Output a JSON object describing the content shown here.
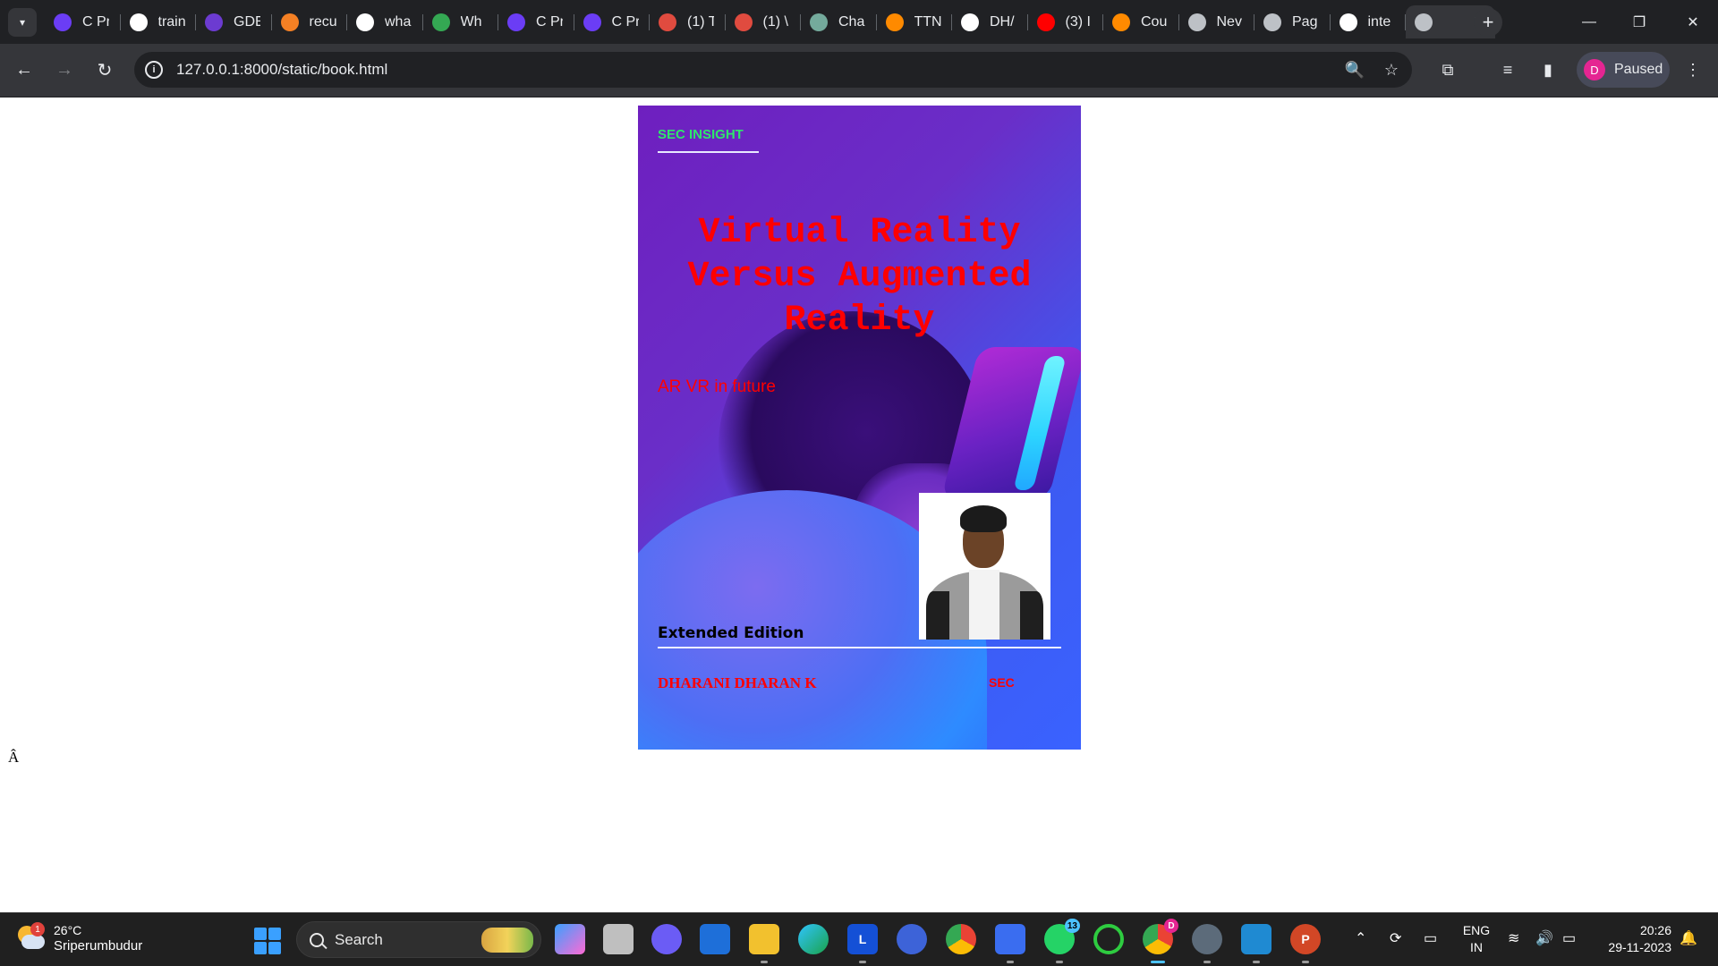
{
  "browser": {
    "tabs": [
      {
        "title": "C Pr",
        "icon": "pw-skills-icon",
        "color": "#6b3df5"
      },
      {
        "title": "train",
        "icon": "google-icon",
        "color": "#ffffff"
      },
      {
        "title": "GDE",
        "icon": "gdevelop-icon",
        "color": "#6c3bd1"
      },
      {
        "title": "recu",
        "icon": "stackoverflow-icon",
        "color": "#f48024"
      },
      {
        "title": "wha",
        "icon": "google-icon",
        "color": "#ffffff"
      },
      {
        "title": "Wh",
        "icon": "loading-icon",
        "color": "#34a853"
      },
      {
        "title": "C Pr",
        "icon": "pw-skills-icon",
        "color": "#6b3df5"
      },
      {
        "title": "C Pr",
        "icon": "pw-skills-icon",
        "color": "#6b3df5"
      },
      {
        "title": "(1) T",
        "icon": "leetcode-icon",
        "color": "#e04b3f"
      },
      {
        "title": "(1) \\",
        "icon": "leetcode-icon",
        "color": "#e04b3f"
      },
      {
        "title": "Cha",
        "icon": "chatgpt-icon",
        "color": "#74aa9c"
      },
      {
        "title": "TTN",
        "icon": "internshala-icon",
        "color": "#ff8a00"
      },
      {
        "title": "DH/",
        "icon": "github-icon",
        "color": "#ffffff"
      },
      {
        "title": "(3) I",
        "icon": "youtube-icon",
        "color": "#ff0000"
      },
      {
        "title": "Cou",
        "icon": "internshala-icon",
        "color": "#ff8a00"
      },
      {
        "title": "Nev",
        "icon": "chrome-icon",
        "color": "#bdc1c6"
      },
      {
        "title": "Pag",
        "icon": "globe-icon",
        "color": "#bdc1c6"
      },
      {
        "title": "inte",
        "icon": "google-icon",
        "color": "#ffffff"
      },
      {
        "title": "",
        "icon": "globe-icon",
        "color": "#bdc1c6",
        "active": true
      }
    ],
    "url": "127.0.0.1:8000/static/book.html",
    "profile_label": "Paused",
    "profile_initial": "D"
  },
  "page": {
    "cover": {
      "brand": "SEC INSIGHT",
      "title": "Virtual Reality Versus Augmented Reality",
      "subtitle": "AR VR in future",
      "edition": "Extended Edition",
      "author": "DHARANI DHARAN K",
      "publisher": "SEC"
    },
    "stray_char": "Â"
  },
  "taskbar": {
    "weather": {
      "temp": "26°C",
      "city": "Sriperumbudur",
      "badge": "1"
    },
    "search_label": "Search",
    "lang": {
      "line1": "ENG",
      "line2": "IN"
    },
    "clock": {
      "time": "20:26",
      "date": "29-11-2023"
    },
    "whatsapp_badge": "13",
    "chrome_badge": "D"
  },
  "colors": {
    "accent_brand": "#2ee66b",
    "title_red": "#ff0000",
    "cover_gradient_start": "#6e1fbf",
    "cover_gradient_end": "#3a62ff"
  }
}
